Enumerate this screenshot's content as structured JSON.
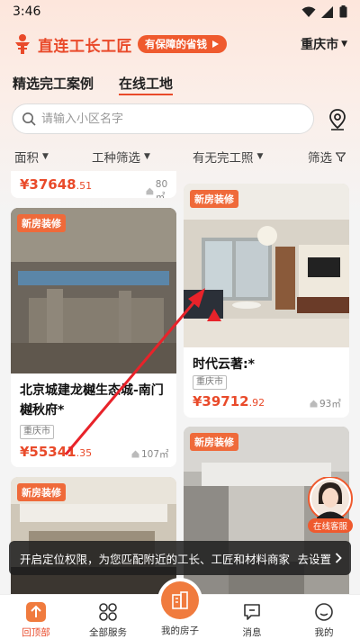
{
  "status_bar": {
    "time": "3:46"
  },
  "header": {
    "brand": "直连工长工匠",
    "slogan": "有保障的省钱",
    "city": "重庆市"
  },
  "top_tabs": [
    {
      "label": "精选完工案例",
      "active": false
    },
    {
      "label": "在线工地",
      "active": true
    }
  ],
  "search": {
    "placeholder": "请输入小区名字"
  },
  "filters": [
    {
      "label": "面积"
    },
    {
      "label": "工种筛选"
    },
    {
      "label": "有无完工照"
    },
    {
      "label": "筛选"
    }
  ],
  "cards": [
    {
      "price_main": "¥37648",
      "price_dec": ".51",
      "area": "80㎡"
    },
    {
      "badge": "新房装修",
      "title": "北京城建龙樾生态城-南门",
      "title2": "樾秋府*",
      "city": "重庆市",
      "price_main": "¥55341",
      "price_dec": ".35",
      "area": "107㎡"
    },
    {
      "badge": "新房装修",
      "title": "时代云著:*",
      "city": "重庆市",
      "price_main": "¥39712",
      "price_dec": ".92",
      "area": "93㎡"
    },
    {
      "badge": "新房装修"
    },
    {
      "badge": "新房装修"
    }
  ],
  "toast": {
    "text": "开启定位权限，为您匹配附近的工长、工匠和材料商家",
    "action": "去设置"
  },
  "online_service": {
    "label": "在线客服"
  },
  "bottom_nav": [
    {
      "label": "回顶部",
      "active": true
    },
    {
      "label": "全部服务",
      "active": false
    },
    {
      "label": "我的房子",
      "active": false
    },
    {
      "label": "消息",
      "active": false
    },
    {
      "label": "我的",
      "active": false
    }
  ],
  "colors": {
    "accent": "#e94a2a",
    "accent_soft": "#f07b3e",
    "badge": "#ef6a3a"
  }
}
